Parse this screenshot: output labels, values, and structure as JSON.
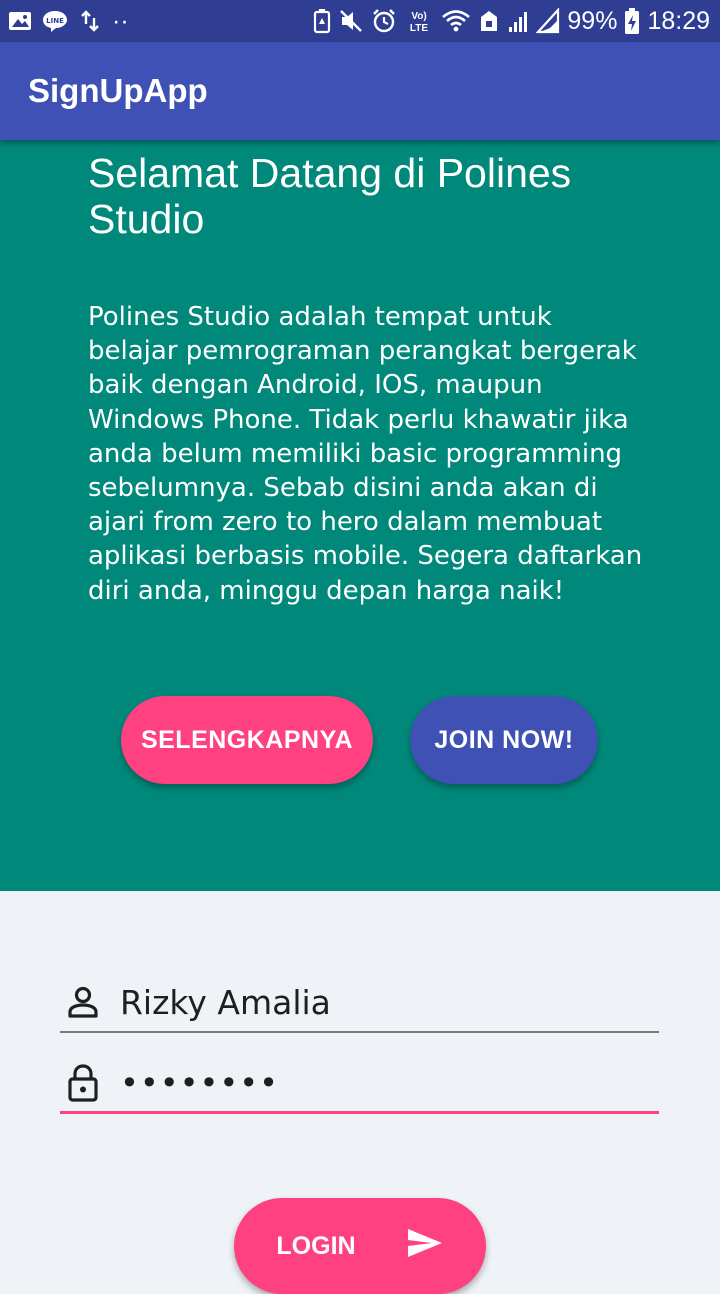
{
  "status_bar": {
    "battery": "99%",
    "time": "18:29",
    "dots": "··",
    "icons_left": [
      "gallery-icon",
      "line-icon",
      "transfer-icon"
    ],
    "icons_right": [
      "battery-saver-icon",
      "mute-icon",
      "alarm-icon",
      "volte-icon",
      "wifi-icon",
      "nfc-icon",
      "signal-icon",
      "signal-icon",
      "battery-charging-icon"
    ],
    "color": "#2f3d93"
  },
  "app_bar": {
    "title": "SignUpApp",
    "color": "#3f51b5"
  },
  "hero": {
    "title": "Selamat Datang di Polines Studio",
    "description": "Polines Studio adalah tempat untuk belajar pemrograman perangkat bergerak baik dengan Android, IOS, maupun Windows Phone. Tidak perlu khawatir jika anda belum memiliki basic programming sebelumnya. Sebab disini anda akan di ajari from zero to hero dalam membuat aplikasi berbasis mobile. Segera daftarkan diri anda, minggu depan harga naik!",
    "color": "#00897b",
    "buttons": {
      "more_label": "SELENGKAPNYA",
      "join_label": "JOIN NOW!"
    }
  },
  "form": {
    "username_value": "Rizky Amalia",
    "password_value": "••••••••",
    "login_label": "LOGIN",
    "accent": "#ff4081"
  }
}
